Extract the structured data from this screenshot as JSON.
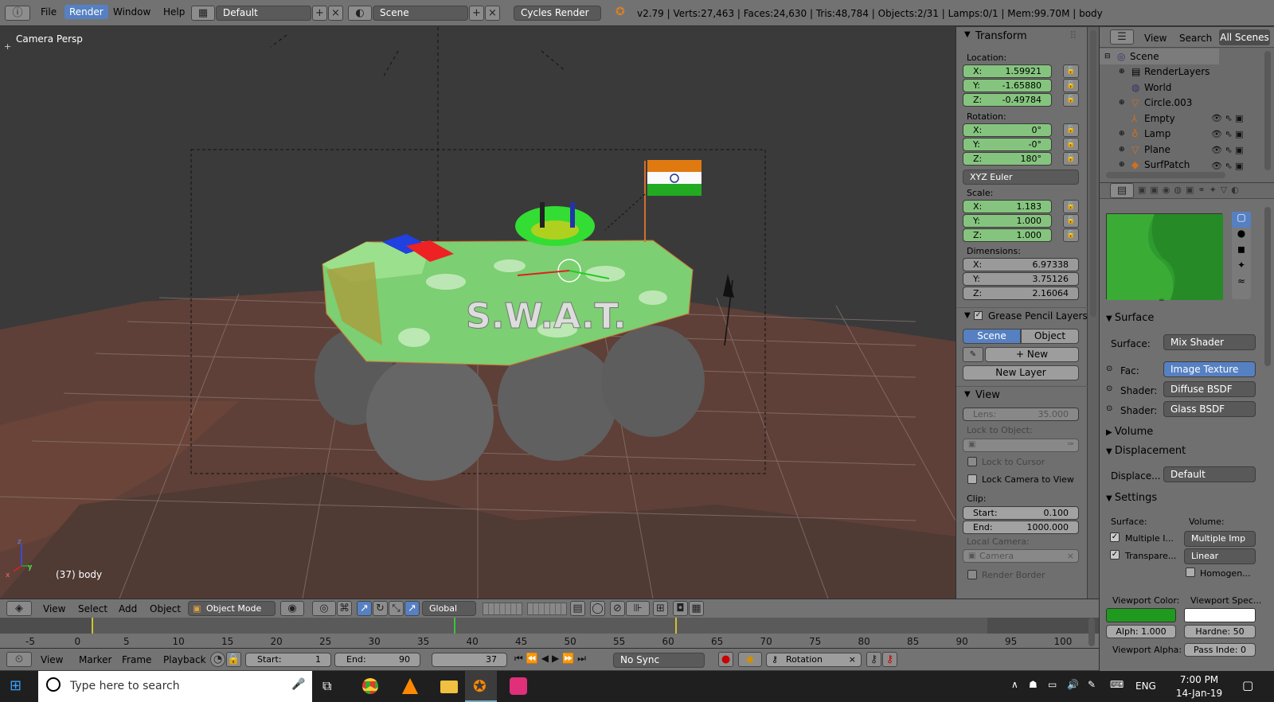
{
  "topbar": {
    "menu": [
      "File",
      "Render",
      "Window",
      "Help"
    ],
    "layout": "Default",
    "scene": "Scene",
    "engine": "Cycles Render",
    "stats": "v2.79 | Verts:27,463 | Faces:24,630 | Tris:48,784 | Objects:2/31 | Lamps:0/1 | Mem:99.70M | body"
  },
  "viewport": {
    "view_label": "Camera Persp",
    "object_label": "(37) body",
    "model_text": "S.W.A.T."
  },
  "n_panel": {
    "transform_title": "Transform",
    "location_label": "Location:",
    "location": {
      "x": "1.59921",
      "y": "-1.65880",
      "z": "-0.49784"
    },
    "rotation_label": "Rotation:",
    "rotation": {
      "x": "0°",
      "y": "-0°",
      "z": "180°"
    },
    "rotation_mode": "XYZ Euler",
    "scale_label": "Scale:",
    "scale": {
      "x": "1.183",
      "y": "1.000",
      "z": "1.000"
    },
    "dimensions_label": "Dimensions:",
    "dimensions": {
      "x": "6.97338",
      "y": "3.75126",
      "z": "2.16064"
    },
    "axis": {
      "x": "X:",
      "y": "Y:",
      "z": "Z:"
    },
    "grease_title": "Grease Pencil Layers",
    "grease_tabs": [
      "Scene",
      "Object"
    ],
    "new_label": "New",
    "new_layer_label": "New Layer",
    "view_title": "View",
    "lens_label": "Lens:",
    "lens_value": "35.000",
    "lock_to_object": "Lock to Object:",
    "lock_to_cursor": "Lock to Cursor",
    "lock_camera": "Lock Camera to View",
    "clip_label": "Clip:",
    "clip_start_label": "Start:",
    "clip_start": "0.100",
    "clip_end_label": "End:",
    "clip_end": "1000.000",
    "local_camera": "Local Camera:",
    "camera_placeholder": "Camera",
    "render_border": "Render Border"
  },
  "outliner": {
    "menu": [
      "View",
      "Search",
      "All Scenes"
    ],
    "items": [
      "Scene",
      "RenderLayers",
      "World",
      "Circle.003",
      "Empty",
      "Lamp",
      "Plane",
      "SurfPatch"
    ]
  },
  "properties": {
    "surface_title": "Surface",
    "surface_label": "Surface:",
    "surface_value": "Mix Shader",
    "fac_label": "Fac:",
    "fac_value": "Image Texture",
    "shader1_label": "Shader:",
    "shader1_value": "Diffuse BSDF",
    "shader2_label": "Shader:",
    "shader2_value": "Glass BSDF",
    "volume_title": "Volume",
    "displacement_title": "Displacement",
    "displace_label": "Displace...",
    "displace_value": "Default",
    "settings_title": "Settings",
    "surface_col": "Surface:",
    "volume_col": "Volume:",
    "multiple_label": "Multiple I...",
    "multiple_value": "Multiple Imp",
    "transparent_label": "Transpare...",
    "linear_value": "Linear",
    "homogen_label": "Homogen...",
    "viewport_color": "Viewport Color:",
    "viewport_spec": "Viewport Spec...",
    "alpha": "Alph: 1.000",
    "hardness": "Hardne: 50",
    "viewport_alpha": "Viewport Alpha:",
    "pass_index": "Pass Inde: 0"
  },
  "view3d_header": {
    "menu": [
      "View",
      "Select",
      "Add",
      "Object"
    ],
    "mode": "Object Mode",
    "orientation": "Global"
  },
  "timeline": {
    "ticks": [
      "-5",
      "0",
      "5",
      "10",
      "15",
      "20",
      "25",
      "30",
      "35",
      "40",
      "45",
      "50",
      "55",
      "60",
      "65",
      "70",
      "75",
      "80",
      "85",
      "90",
      "95",
      "100"
    ],
    "menu": [
      "View",
      "Marker",
      "Frame",
      "Playback"
    ],
    "start_label": "Start:",
    "start": "1",
    "end_label": "End:",
    "end": "90",
    "current": "37",
    "sync": "No Sync",
    "keying": "Rotation"
  },
  "taskbar": {
    "search_placeholder": "Type here to search",
    "lang": "ENG",
    "time": "7:00 PM",
    "date": "14-Jan-19"
  }
}
